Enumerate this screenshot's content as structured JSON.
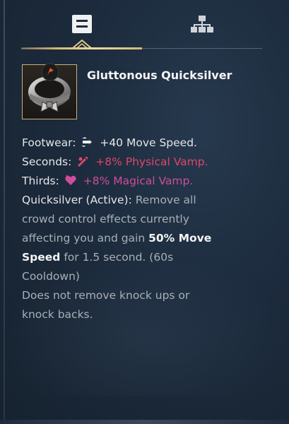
{
  "tabs": [
    {
      "name": "details",
      "icon": "details-icon",
      "active": true
    },
    {
      "name": "build-tree",
      "icon": "build-tree-icon",
      "active": false
    }
  ],
  "item": {
    "icon": "quicksilver-sash-icon",
    "rune_icon": "orange-emblem-icon",
    "name": "Gluttonous Quicksilver"
  },
  "stats": {
    "footwear_label": "Footwear:",
    "footwear_value": "+40 Move Speed.",
    "seconds_label": "Seconds:",
    "seconds_value": "+8% Physical Vamp.",
    "thirds_label": "Thirds:",
    "thirds_value": "+8% Magical Vamp."
  },
  "active": {
    "label": "Quicksilver (Active):",
    "text_1": "Remove all",
    "text_2": "crowd control effects currently",
    "text_3a": "affecting you and gain",
    "text_3b": "50% Move",
    "text_4a": "Speed",
    "text_4b": "for 1.5 second.",
    "text_4c": "(60s",
    "text_5": "Cooldown)",
    "note_1": "Does not remove knock ups or",
    "note_2": "knock backs."
  },
  "colors": {
    "physical_vamp": "#e0446a",
    "magical_vamp": "#cf4d9b",
    "accent_gold": "#d7b773",
    "muted_text": "#a9afb7"
  }
}
